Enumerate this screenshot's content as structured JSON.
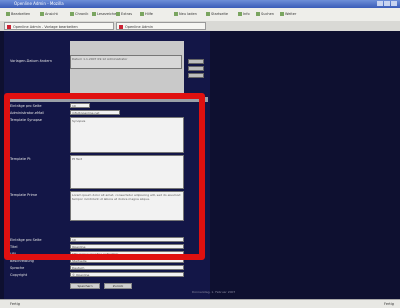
{
  "window": {
    "title": "Openline Admin - Mozilla"
  },
  "menu": [
    "Bearbeiten",
    "Ansicht",
    "Chronik",
    "Lesezeichen",
    "Extras",
    "Hilfe",
    "Neu laden",
    "Startseite",
    "Info",
    "Suchen",
    "Weiter"
  ],
  "tabs": [
    "Openline Admin - Vorlage bearbeiten",
    "Openline Admin"
  ],
  "form": {
    "top_label": "Vorlagen-Datum ändern",
    "top_value": "Datum 1.1.2007 09:12 Administrator",
    "fields": [
      {
        "label": "Einträge pro Seite",
        "value": "10"
      },
      {
        "label": "Administrator-eMail",
        "value": "info@openline.net"
      },
      {
        "label": "Template Synopse",
        "value": "Synopsis"
      },
      {
        "label": "Template Pt",
        "value": "Pt Text"
      },
      {
        "label": "Template Prime",
        "value": "Lorem ipsum dolor sit amet, consectetur adipiscing elit, sed do eiusmod tempor incididunt ut labore et dolore magna aliqua."
      }
    ],
    "lower_fields": [
      {
        "label": "Einträge pro Seite",
        "value": "10"
      },
      {
        "label": "Titel",
        "value": "Openline"
      },
      {
        "label": "URL",
        "value": "http://www.openline.net/admin"
      },
      {
        "label": "Beschreibung",
        "value": "Startseite"
      },
      {
        "label": "Sprache",
        "value": "Deutsch"
      },
      {
        "label": "Copyright",
        "value": "© Openline"
      }
    ],
    "buttons": {
      "save": "Speichern",
      "reset": "Zurück"
    }
  },
  "footer": {
    "datetime": "Donnerstag, 1. Februar 2007"
  },
  "statusbar": {
    "text": "Fertig",
    "right": "Fertig"
  }
}
